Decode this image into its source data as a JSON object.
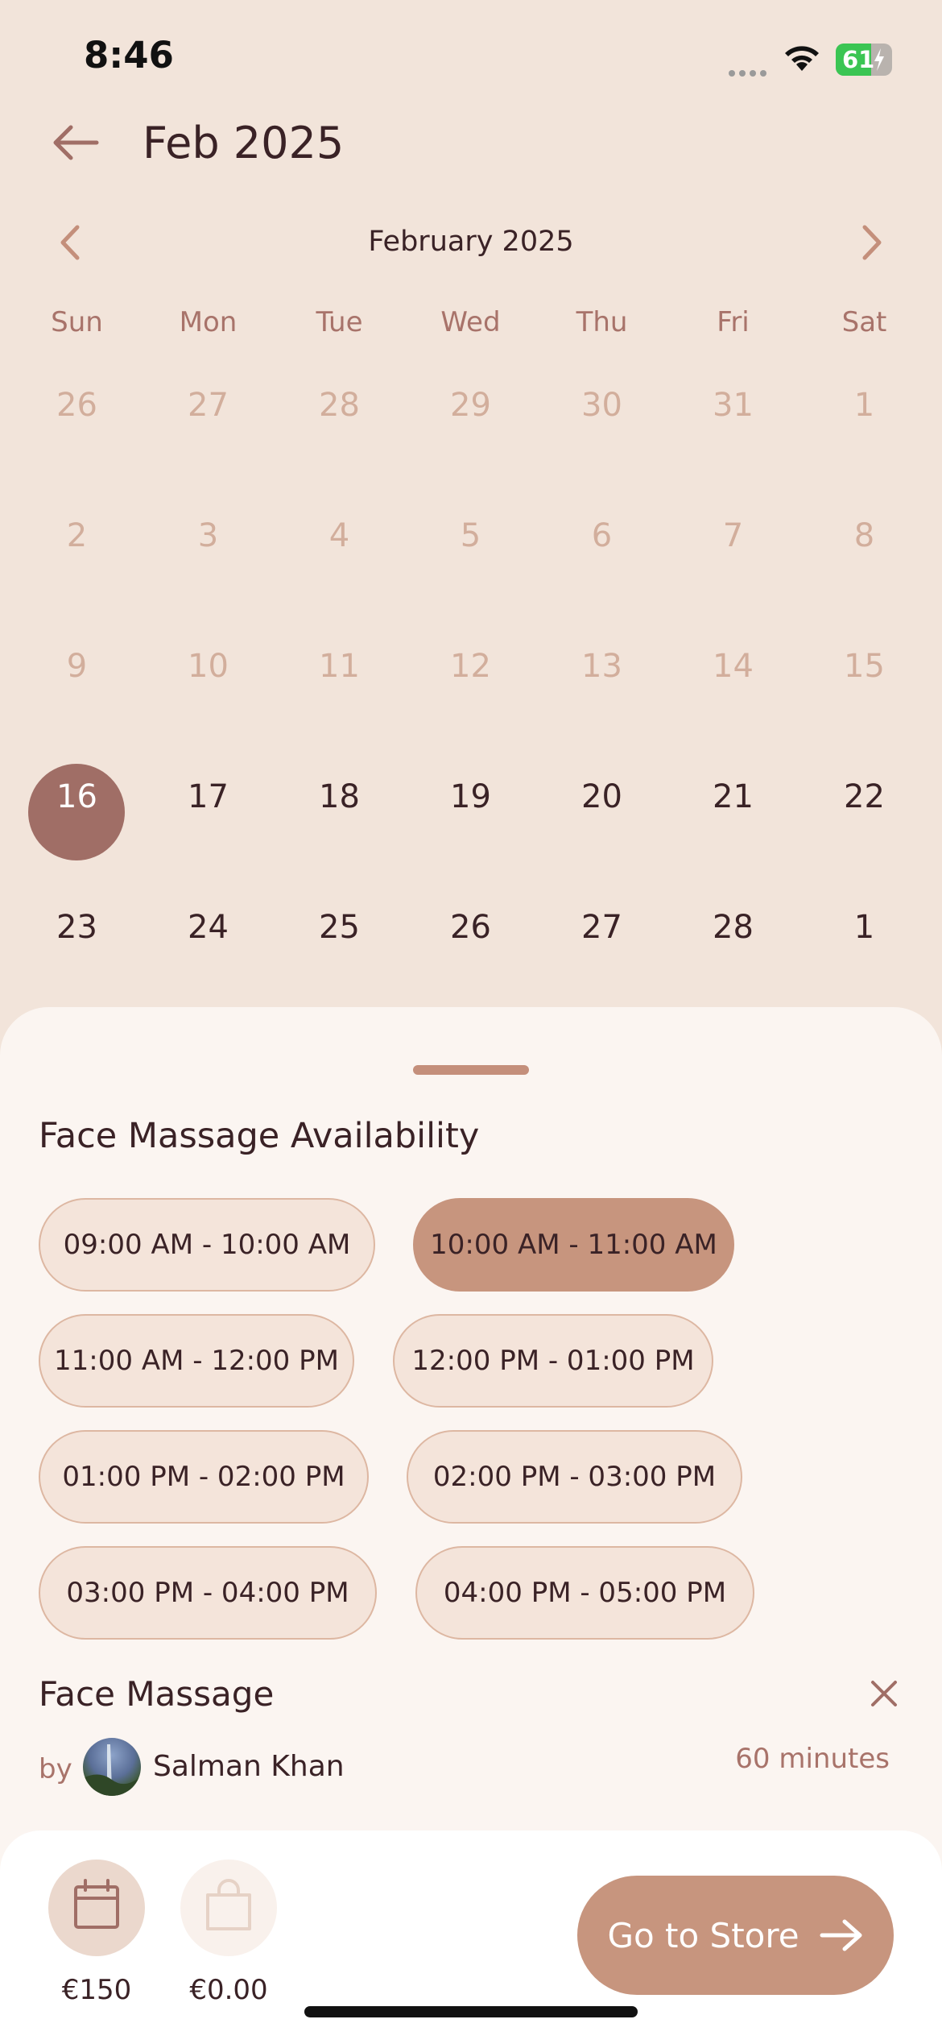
{
  "status": {
    "time": "8:46",
    "battery": "61"
  },
  "header": {
    "title": "Feb 2025"
  },
  "calendar": {
    "month_label": "February 2025",
    "weekdays": [
      "Sun",
      "Mon",
      "Tue",
      "Wed",
      "Thu",
      "Fri",
      "Sat"
    ],
    "weeks": [
      [
        "26",
        "27",
        "28",
        "29",
        "30",
        "31",
        "1"
      ],
      [
        "2",
        "3",
        "4",
        "5",
        "6",
        "7",
        "8"
      ],
      [
        "9",
        "10",
        "11",
        "12",
        "13",
        "14",
        "15"
      ],
      [
        "16",
        "17",
        "18",
        "19",
        "20",
        "21",
        "22"
      ],
      [
        "23",
        "24",
        "25",
        "26",
        "27",
        "28",
        "1"
      ]
    ],
    "selected": "16"
  },
  "availability": {
    "title": "Face Massage Availability",
    "slots": [
      "09:00 AM - 10:00 AM",
      "10:00 AM - 11:00 AM",
      "11:00 AM - 12:00 PM",
      "12:00 PM - 01:00 PM",
      "01:00 PM - 02:00 PM",
      "02:00 PM - 03:00 PM",
      "03:00 PM - 04:00 PM",
      "04:00 PM - 05:00 PM"
    ],
    "selected_slot": "10:00 AM - 11:00 AM"
  },
  "service": {
    "name": "Face Massage",
    "by_label": "by",
    "provider": "Salman Khan",
    "duration": "60 minutes"
  },
  "bottom_bar": {
    "booking_price": "€150",
    "cart_price": "€0.00",
    "store_button": "Go to Store"
  },
  "colors": {
    "background": "#F2E4DA",
    "accent": "#C7957E",
    "selected_day": "#A06E66",
    "text_dark": "#3A2226",
    "text_muted": "#A8736A"
  }
}
